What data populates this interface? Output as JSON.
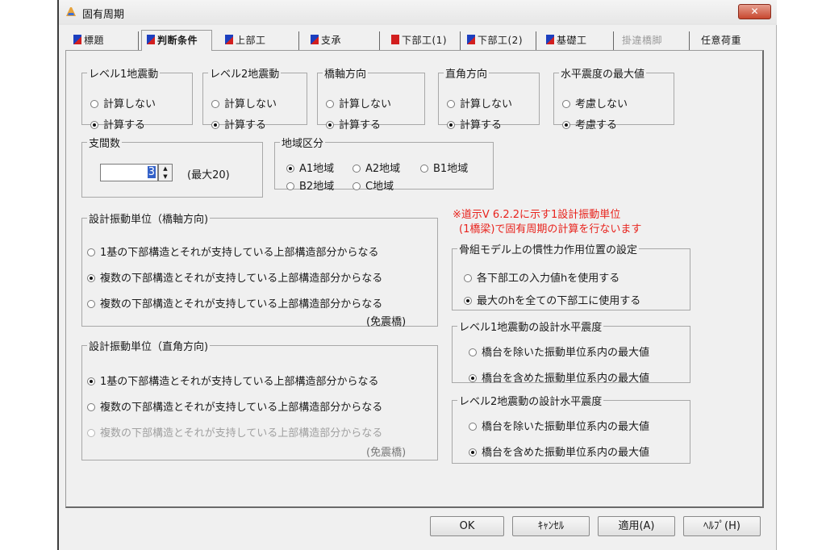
{
  "window": {
    "title": "固有周期",
    "close_label": "✕"
  },
  "tabs": [
    {
      "label": "標題"
    },
    {
      "label": "判断条件"
    },
    {
      "label": "上部工"
    },
    {
      "label": "支承"
    },
    {
      "label": "下部工(1)"
    },
    {
      "label": "下部工(2)"
    },
    {
      "label": "基礎工"
    },
    {
      "label": "掛違橋脚"
    },
    {
      "label": "任意荷重"
    }
  ],
  "groups": {
    "level1": {
      "title": "レベル1地震動",
      "opt1": "計算しない",
      "opt2": "計算する",
      "selected": 2
    },
    "level2": {
      "title": "レベル2地震動",
      "opt1": "計算しない",
      "opt2": "計算する",
      "selected": 2
    },
    "bridge_axis": {
      "title": "橋軸方向",
      "opt1": "計算しない",
      "opt2": "計算する",
      "selected": 2
    },
    "perpendicular": {
      "title": "直角方向",
      "opt1": "計算しない",
      "opt2": "計算する",
      "selected": 2
    },
    "max_horizontal": {
      "title": "水平震度の最大値",
      "opt1": "考慮しない",
      "opt2": "考慮する",
      "selected": 2
    },
    "span_count": {
      "title": "支間数",
      "value": "3",
      "hint": "(最大20)"
    },
    "region": {
      "title": "地域区分",
      "opt1": "A1地域",
      "opt2": "A2地域",
      "opt3": "B1地域",
      "opt4": "B2地域",
      "opt5": "C地域",
      "selected": 1
    },
    "vib_unit_axis": {
      "title": "設計振動単位（橋軸方向)",
      "opt1": "1基の下部構造とそれが支持している上部構造部分からなる",
      "opt2": "複数の下部構造とそれが支持している上部構造部分からなる",
      "opt3": "複数の下部構造とそれが支持している上部構造部分からなる",
      "opt3_suffix": "(免震橋)",
      "selected": 2
    },
    "vib_unit_perp": {
      "title": "設計振動単位（直角方向)",
      "opt1": "1基の下部構造とそれが支持している上部構造部分からなる",
      "opt2": "複数の下部構造とそれが支持している上部構造部分からなる",
      "opt3": "複数の下部構造とそれが支持している上部構造部分からなる",
      "opt3_suffix": "(免震橋)",
      "selected": 1
    },
    "inertia": {
      "title": "骨組モデル上の慣性力作用位置の設定",
      "opt1": "各下部工の入力値hを使用する",
      "opt2": "最大のhを全ての下部工に使用する",
      "selected": 2
    },
    "level1_design": {
      "title": "レベル1地震動の設計水平震度",
      "opt1": "橋台を除いた振動単位系内の最大値",
      "opt2": "橋台を含めた振動単位系内の最大値",
      "selected": 2
    },
    "level2_design": {
      "title": "レベル2地震動の設計水平震度",
      "opt1": "橋台を除いた振動単位系内の最大値",
      "opt2": "橋台を含めた振動単位系内の最大値",
      "selected": 2
    }
  },
  "note": {
    "line1": "※道示V 6.2.2に示す1設計振動単位",
    "line2": "(1橋梁)で固有周期の計算を行ないます"
  },
  "buttons": {
    "ok": "OK",
    "cancel": "ｷｬﾝｾﾙ",
    "apply": "適用(A)",
    "help": "ﾍﾙﾌﾟ(H)"
  }
}
